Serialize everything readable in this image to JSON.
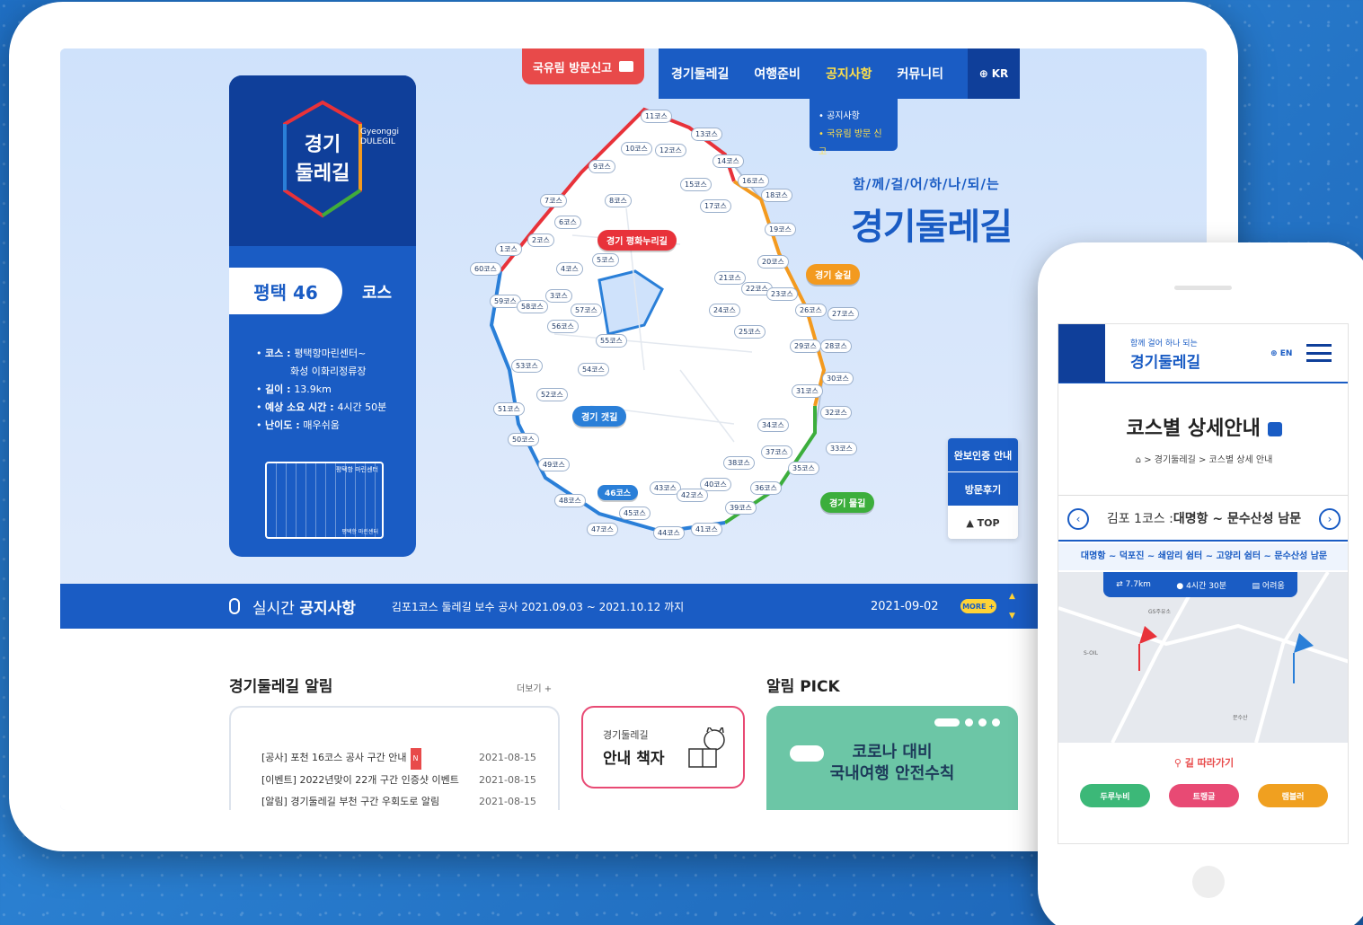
{
  "nav": {
    "report_tab": "국유림 방문신고",
    "items": [
      "경기둘레길",
      "여행준비",
      "공지사항",
      "커뮤니티"
    ],
    "active_index": 2,
    "lang": "KR",
    "dropdown": [
      "• 공지사항",
      "• 국유림 방문 신고"
    ]
  },
  "brand": {
    "logo_en_1": "Gyeonggi",
    "logo_en_2": "DULEGIL",
    "logo_ko": "경기둘레길",
    "course_pill": "평택 46",
    "course_word": "코스",
    "info": [
      {
        "label": "코스 : ",
        "value": "평택항마린센터~"
      },
      {
        "label": "",
        "value": "화성 이화리정류장"
      },
      {
        "label": "길이 : ",
        "value": "13.9km"
      },
      {
        "label": "예상 소요 시간 : ",
        "value": "4시간 50분"
      },
      {
        "label": "난이도 : ",
        "value": "매우쉬움"
      }
    ],
    "illu_caption": "평택항 마린센터",
    "illu_caption2": "평택항 마린센터"
  },
  "map": {
    "badges": [
      "11코스",
      "13코스",
      "10코스",
      "12코스",
      "14코스",
      "9코스",
      "16코스",
      "15코스",
      "18코스",
      "8코스",
      "7코스",
      "17코스",
      "6코스",
      "19코스",
      "2코스",
      "1코스",
      "5코스",
      "20코스",
      "4코스",
      "21코스",
      "60코스",
      "22코스",
      "23코스",
      "3코스",
      "59코스",
      "58코스",
      "57코스",
      "26코스",
      "27코스",
      "24코스",
      "56코스",
      "25코스",
      "55코스",
      "29코스",
      "28코스",
      "53코스",
      "54코스",
      "30코스",
      "31코스",
      "52코스",
      "51코스",
      "32코스",
      "34코스",
      "50코스",
      "33코스",
      "37코스",
      "49코스",
      "38코스",
      "35코스",
      "46코스",
      "36코스",
      "40코스",
      "43코스",
      "42코스",
      "48코스",
      "39코스",
      "45코스",
      "41코스",
      "47코스",
      "44코스"
    ],
    "routes": [
      {
        "label": "경기 평화누리길",
        "color": "#e8323a"
      },
      {
        "label": "경기 숲길",
        "color": "#f39a1f"
      },
      {
        "label": "경기 갯길",
        "color": "#2a7fd8"
      },
      {
        "label": "경기 물길",
        "color": "#3cae3c"
      }
    ],
    "highlight": "46코스"
  },
  "slogan": {
    "small": "함/께/걸/어/하/나/되/는",
    "large": "경기둘레길"
  },
  "side_buttons": {
    "cert": "완보인증 안내",
    "review": "방문후기",
    "top": "▲ TOP"
  },
  "notice": {
    "label_prefix": "실시간 ",
    "label_bold": "공지사항",
    "text": "김포1코스 둘레길 보수 공사 2021.09.03 ~ 2021.10.12 까지",
    "date": "2021-09-02",
    "more": "MORE +"
  },
  "news": {
    "title": "경기둘레길 알림",
    "more": "더보기 +",
    "rows": [
      {
        "title": "[공사] 포천 16코스 공사 구간 안내",
        "date": "2021-08-15",
        "new": "N"
      },
      {
        "title": "[이벤트] 2022년맞이 22개 구간 인증샷 이벤트",
        "date": "2021-08-15"
      },
      {
        "title": "[알림] 경기둘레길 부천 구간 우회도로 알림",
        "date": "2021-08-15"
      }
    ]
  },
  "guide": {
    "small": "경기둘레길",
    "large": "안내 책자"
  },
  "pick": {
    "title": "알림 PICK",
    "line1": "코로나 대비",
    "line2": "국내여행 안전수칙"
  },
  "phone": {
    "header_sub": "함께 걸어 하나 되는",
    "header_title": "경기둘레길",
    "lang": "EN",
    "page_title": "코스별 상세안내",
    "breadcrumb": "⌂ > 경기둘레길 > 코스별 상세 안내",
    "course_prefix": "김포 1코스 : ",
    "course_name": "대명항 ~ 문수산성 남문",
    "route": "대명항 ~ 덕포진 ~ 쇄암리 쉼터 ~ 고양리 쉼터 ~ 문수산성 남문",
    "stats": [
      "7.7km",
      "4시간 30분",
      "어려움"
    ],
    "map_labels": [
      "GS주유소",
      "S-OIL",
      "문수산"
    ],
    "follow": "길 따라가기",
    "apps": [
      {
        "label": "두루누비",
        "color": "#3cb878"
      },
      {
        "label": "트랭글",
        "color": "#e84a74"
      },
      {
        "label": "램블러",
        "color": "#f0a020"
      }
    ]
  }
}
